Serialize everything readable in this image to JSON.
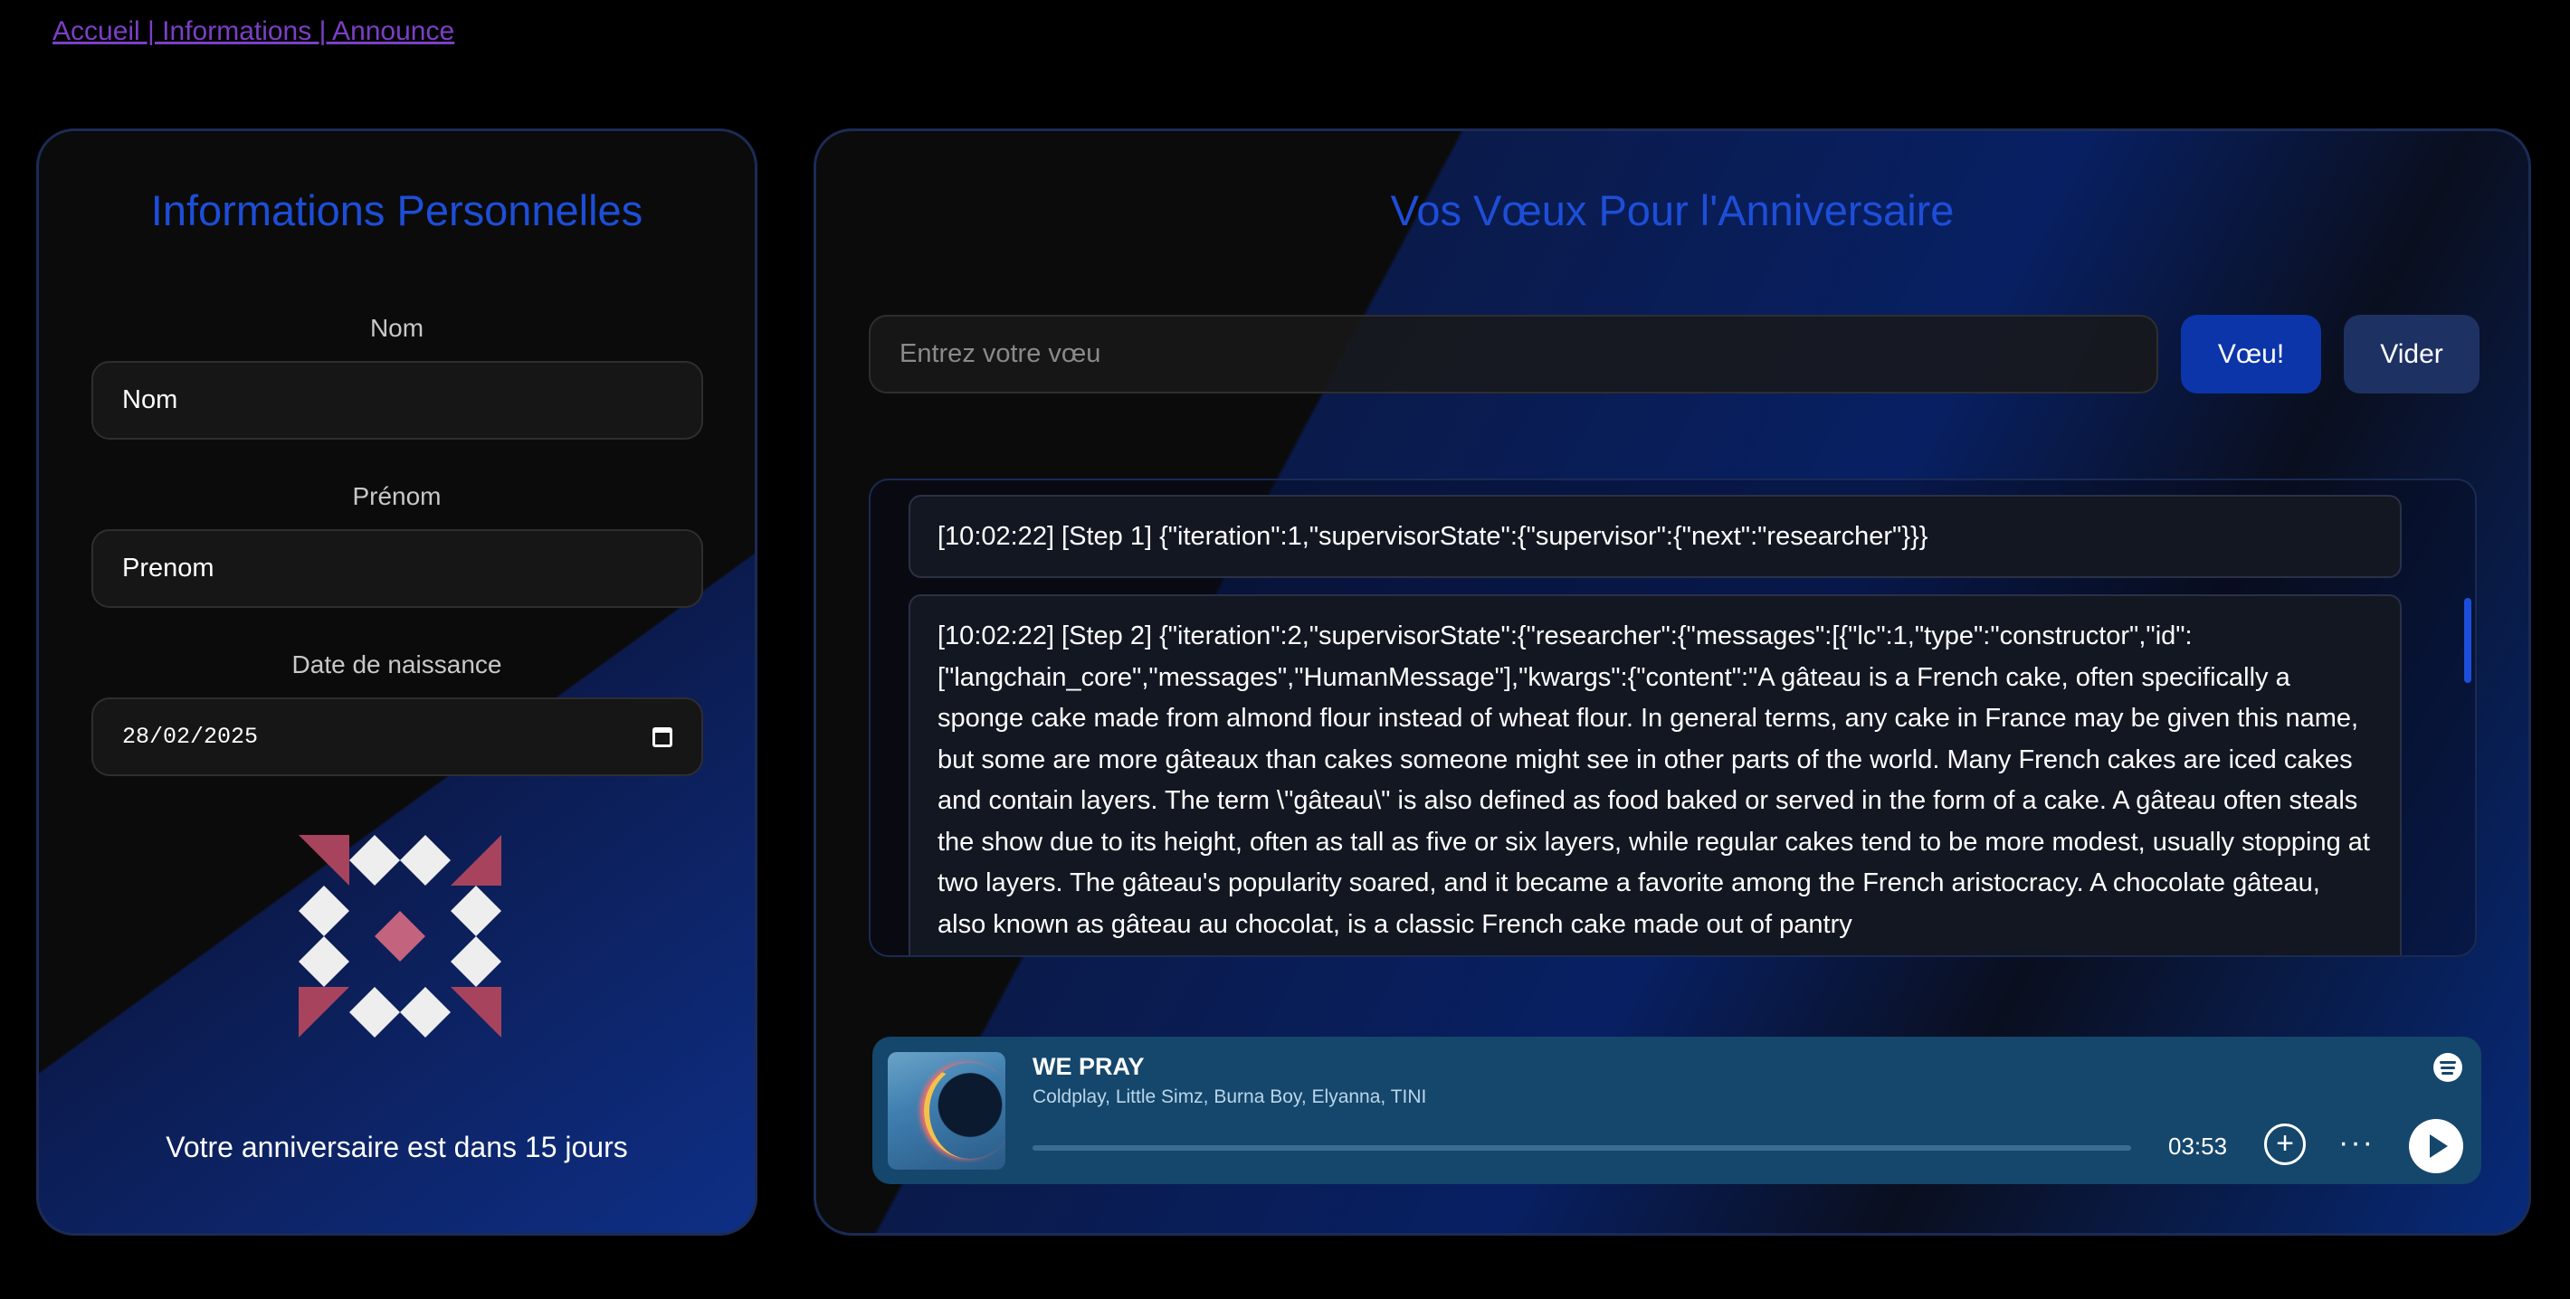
{
  "nav": {
    "text": "Accueil | Informations | Announce"
  },
  "personal": {
    "title": "Informations Personnelles",
    "nom_label": "Nom",
    "nom_value": "Nom",
    "prenom_label": "Prénom",
    "prenom_value": "Prenom",
    "dob_label": "Date de naissance",
    "dob_value": "28/02/2025",
    "countdown": "Votre anniversaire est dans 15 jours"
  },
  "wishes": {
    "title": "Vos Vœux Pour l'Anniversaire",
    "input_placeholder": "Entrez votre vœu",
    "wish_button": "Vœu!",
    "clear_button": "Vider",
    "log": [
      "[10:02:22] [Step 1] {\"iteration\":1,\"supervisorState\":{\"supervisor\":{\"next\":\"researcher\"}}}",
      "[10:02:22] [Step 2] {\"iteration\":2,\"supervisorState\":{\"researcher\":{\"messages\":[{\"lc\":1,\"type\":\"constructor\",\"id\":[\"langchain_core\",\"messages\",\"HumanMessage\"],\"kwargs\":{\"content\":\"A gâteau is a French cake, often specifically a sponge cake made from almond flour instead of wheat flour. In general terms, any cake in France may be given this name, but some are more gâteaux than cakes someone might see in other parts of the world. Many French cakes are iced cakes and contain layers. The term \\\"gâteau\\\" is also defined as food baked or served in the form of a cake. A gâteau often steals the show due to its height, often as tall as five or six layers, while regular cakes tend to be more modest, usually stopping at two layers. The gâteau's popularity soared, and it became a favorite among the French aristocracy. A chocolate gâteau, also known as gâteau au chocolat, is a classic French cake made out of pantry"
    ]
  },
  "player": {
    "title": "WE PRAY",
    "artists": "Coldplay, Little Simz, Burna Boy, Elyanna, TINI",
    "time": "03:53",
    "progress": 0.0
  },
  "colors": {
    "accent": "#1d4ed8",
    "nav_link": "#7b3fc6",
    "player_bg": "#15466b",
    "avatar_pink": "#a8435e",
    "avatar_light": "#eeeeee"
  }
}
